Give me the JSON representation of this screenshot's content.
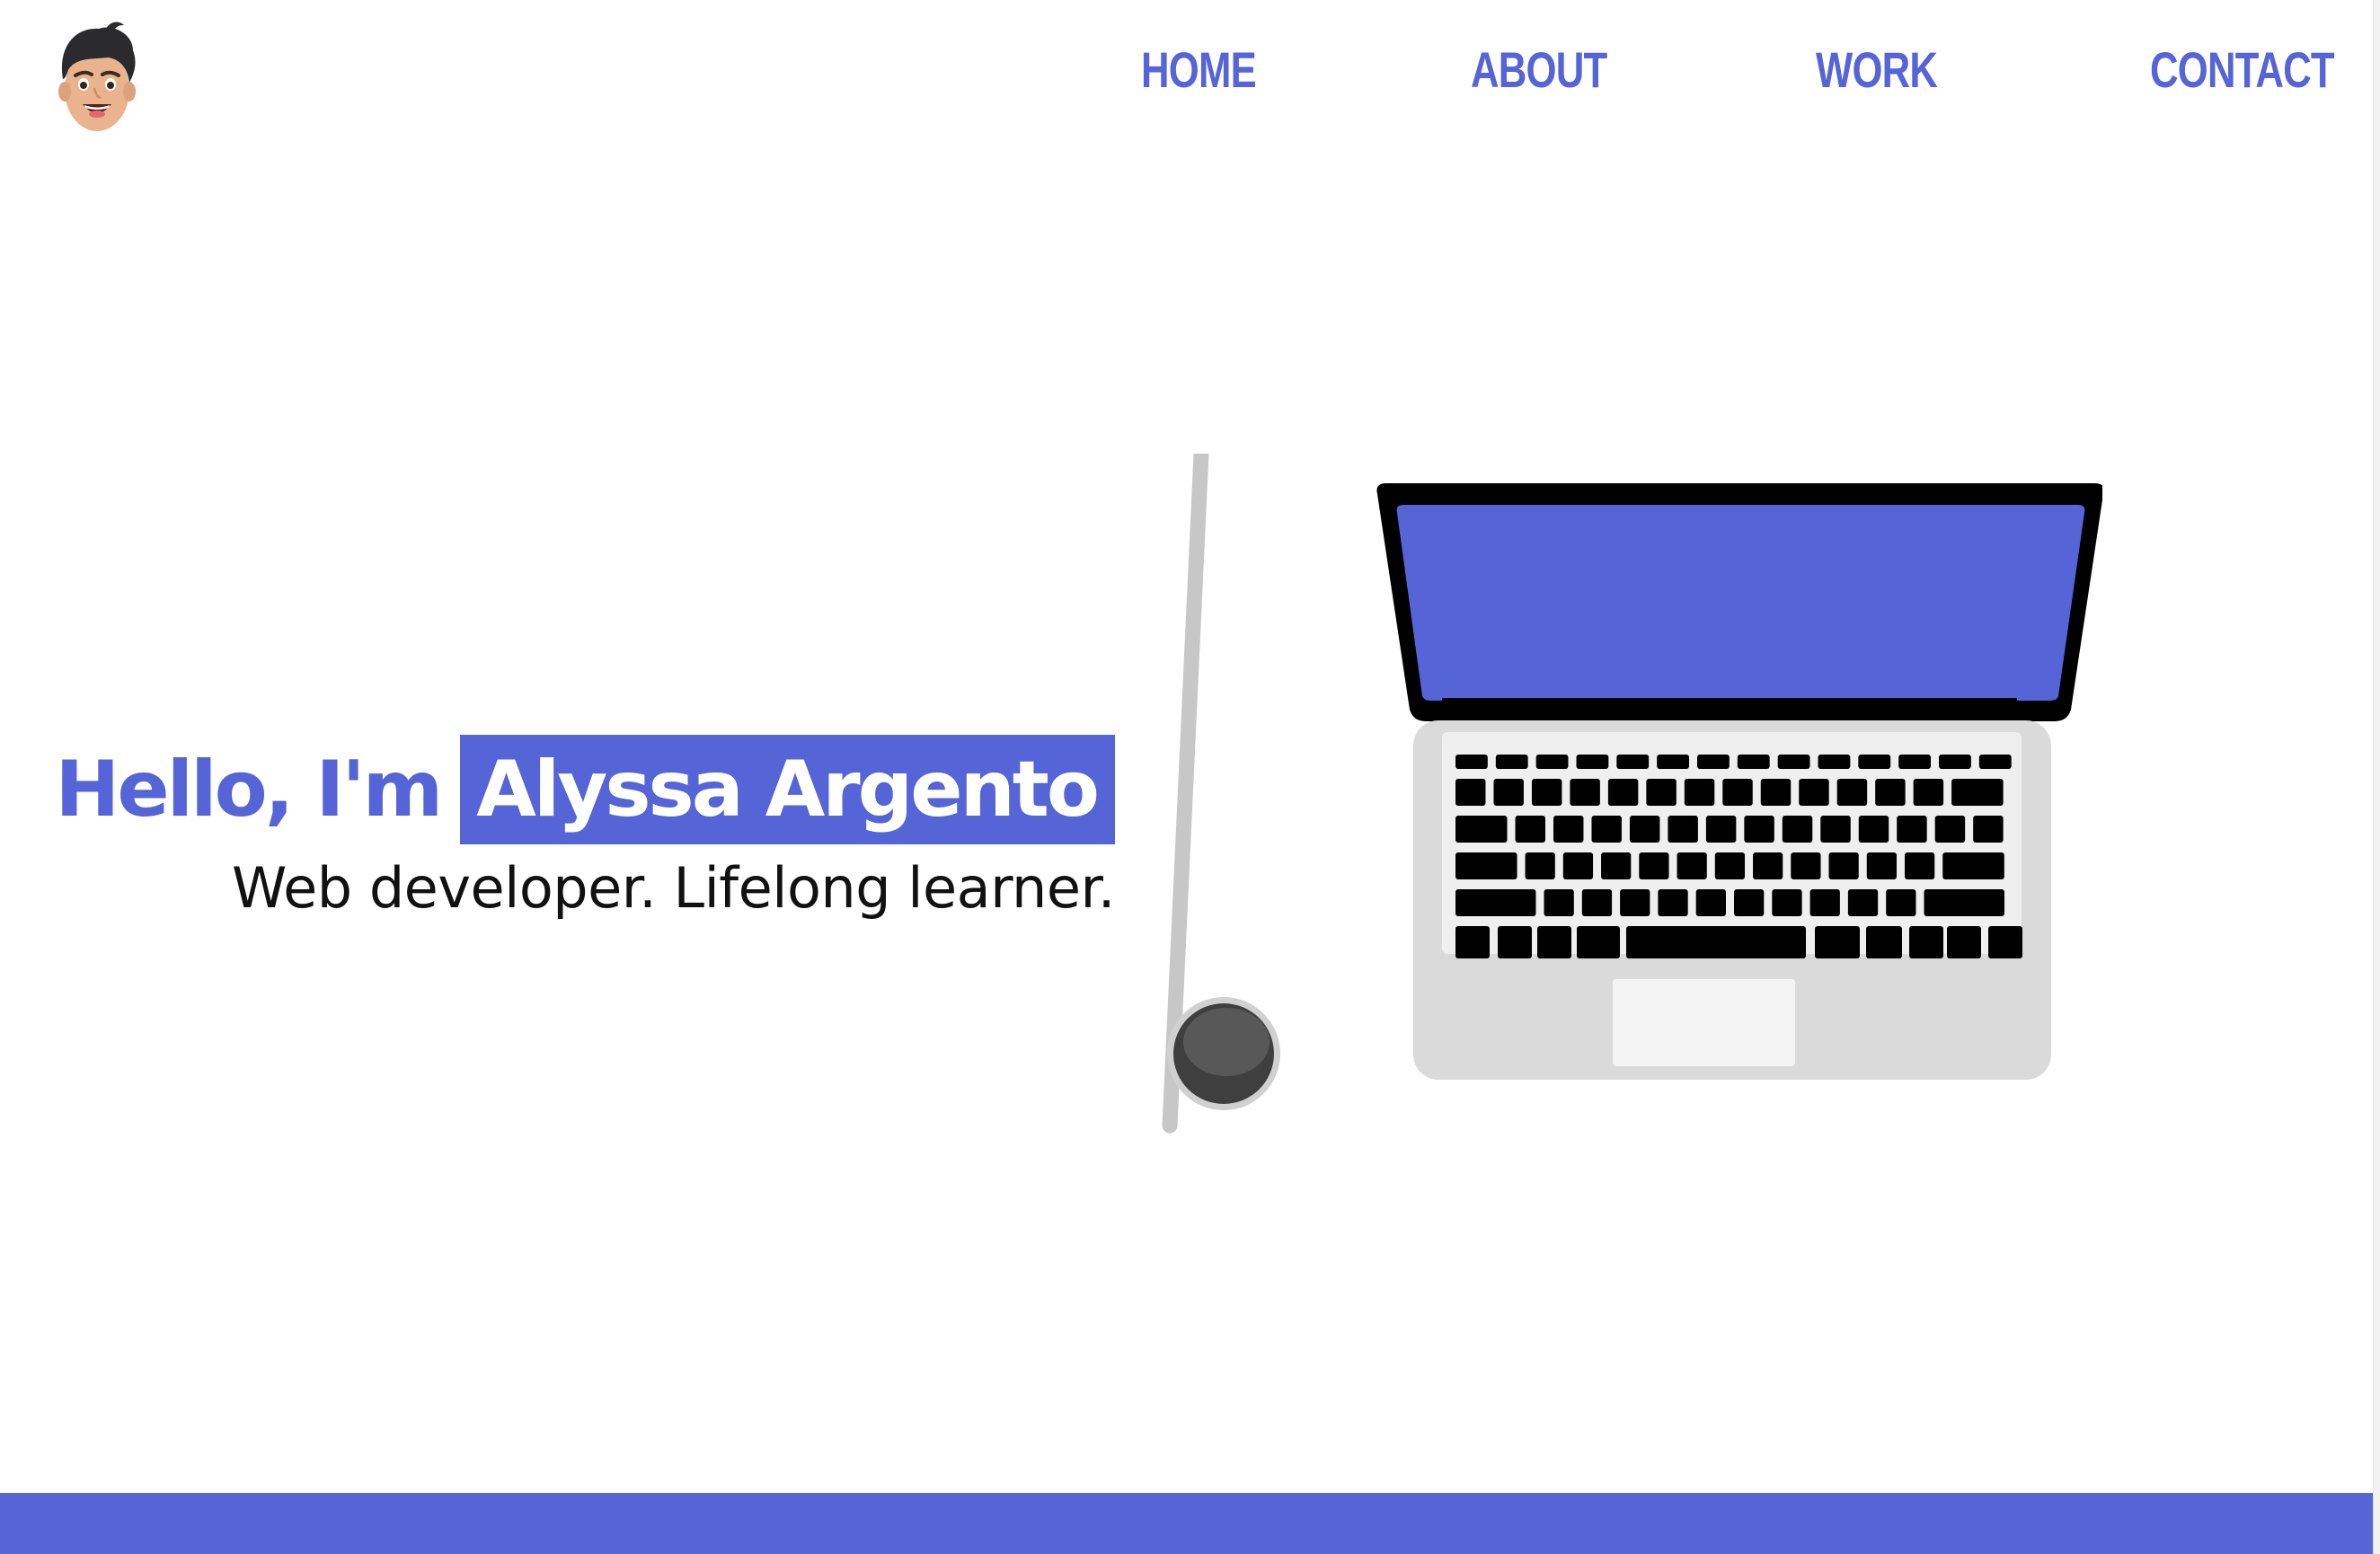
{
  "header": {
    "avatar": "memoji-avatar-icon",
    "nav": [
      {
        "label": "HOME"
      },
      {
        "label": "ABOUT"
      },
      {
        "label": "WORK"
      },
      {
        "label": "CONTACT"
      }
    ]
  },
  "hero": {
    "greeting": "Hello, I'm",
    "name": "Alyssa Argento",
    "tagline": "Web developer. Lifelong learner.",
    "illustration": {
      "laptop": "laptop-icon",
      "mug": "coffee-mug-icon"
    }
  },
  "colors": {
    "accent": "#5564d6",
    "text": "#111111",
    "background": "#ffffff"
  }
}
